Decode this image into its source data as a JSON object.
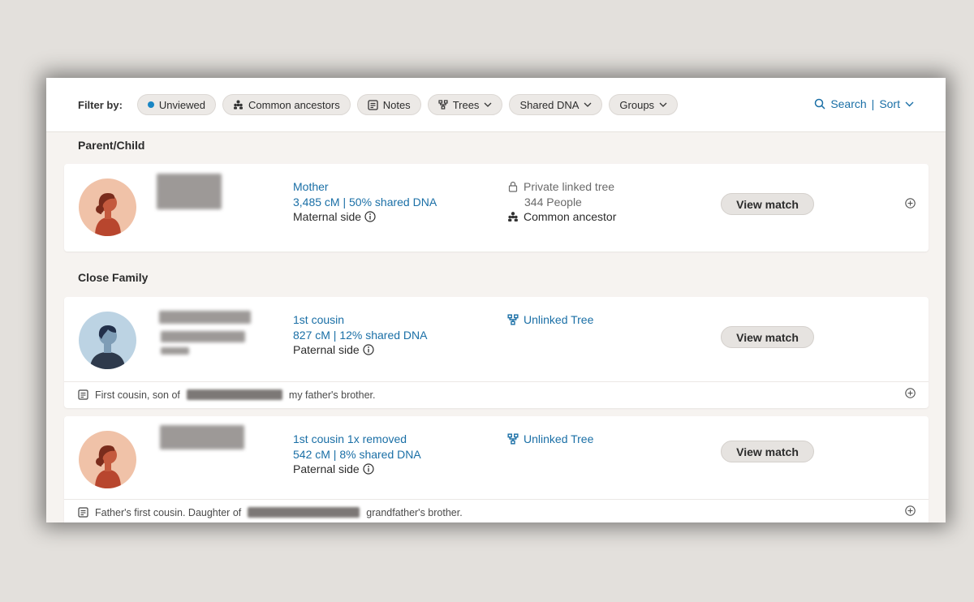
{
  "filters": {
    "label": "Filter by:",
    "chips": [
      {
        "label": "Unviewed"
      },
      {
        "label": "Common ancestors"
      },
      {
        "label": "Notes"
      },
      {
        "label": "Trees"
      },
      {
        "label": "Shared DNA"
      },
      {
        "label": "Groups"
      }
    ],
    "search_label": "Search",
    "separator": "|",
    "sort_label": "Sort"
  },
  "sections": [
    {
      "title": "Parent/Child",
      "matches": [
        {
          "relationship": "Mother",
          "dna": "3,485 cM | 50% shared DNA",
          "side": "Maternal side",
          "tree_status": "Private linked tree",
          "tree_people": "344 People",
          "common_ancestor": "Common ancestor",
          "view_label": "View match",
          "avatar": "female-avatar"
        }
      ]
    },
    {
      "title": "Close Family",
      "matches": [
        {
          "relationship": "1st cousin",
          "dna": "827 cM | 12% shared DNA",
          "side": "Paternal side",
          "tree_status": "Unlinked Tree",
          "view_label": "View match",
          "avatar": "male-avatar",
          "note_before": "First cousin, son of",
          "note_after": "my father's brother."
        },
        {
          "relationship": "1st cousin 1x removed",
          "dna": "542 cM | 8% shared DNA",
          "side": "Paternal side",
          "tree_status": "Unlinked Tree",
          "view_label": "View match",
          "avatar": "female-avatar",
          "note_before": "Father's first cousin. Daughter of",
          "note_after": "grandfather's brother."
        }
      ]
    }
  ],
  "colors": {
    "link": "#1a6fa6",
    "unviewed_dot": "#1a86c4",
    "female_avatar_bg": "#f0c2a8",
    "male_avatar_bg": "#bcd3e3"
  }
}
